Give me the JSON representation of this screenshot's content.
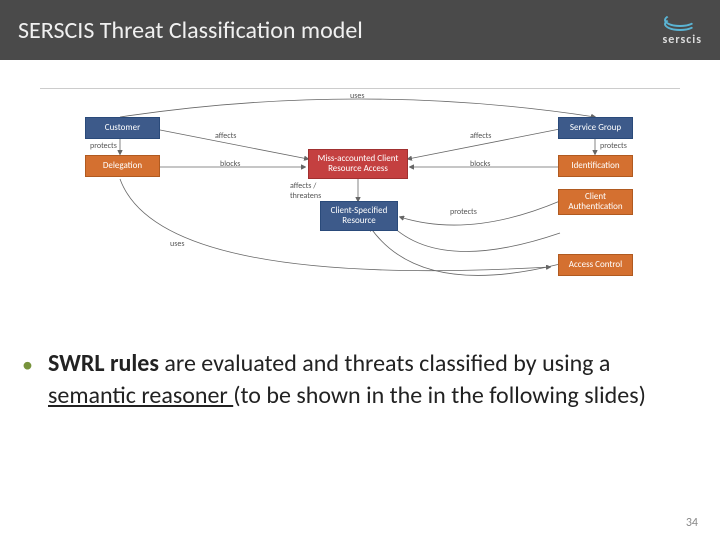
{
  "header": {
    "title": "SERSCIS Threat Classification model",
    "logo_text": "serscis"
  },
  "diagram": {
    "boxes": {
      "customer": "Customer",
      "delegation": "Delegation",
      "threat": "Miss-accounted Client Resource Access",
      "resource": "Client-Specified Resource",
      "service_group": "Service Group",
      "identification": "Identification",
      "client_auth": "Client Authentication",
      "access_control": "Access Control"
    },
    "labels": {
      "uses_top": "uses",
      "affects1": "affects",
      "affects2": "affects",
      "protects1": "protects",
      "protects2": "protects",
      "blocks1": "blocks",
      "blocks2": "blocks",
      "affects_threatens": "affects / threatens",
      "protects3": "protects",
      "uses_bottom": "uses"
    }
  },
  "bullet": {
    "bold1": "SWRL rules",
    "text1": " are evaluated and threats classified by using a ",
    "under": "semantic reasoner ",
    "text2": "(to be shown in the in the following slides)"
  },
  "page": "34"
}
